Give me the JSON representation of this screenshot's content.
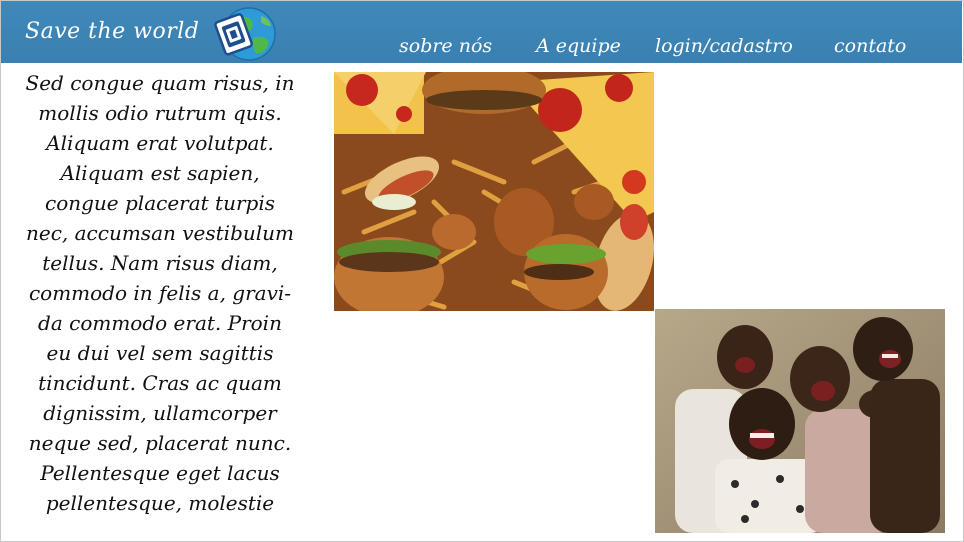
{
  "header": {
    "brand": "Save the world",
    "logo_icon": "globe-logo-icon",
    "background": "#3a80b0"
  },
  "nav": {
    "items": [
      {
        "label": "sobre nós"
      },
      {
        "label": "A equipe"
      },
      {
        "label": "login/cadastro"
      },
      {
        "label": "contato"
      }
    ]
  },
  "main": {
    "text_lines": [
      "Sed congue quam risus, in",
      "mollis odio rutrum quis.",
      "Aliquam erat volutpat.",
      "Aliquam est sapien,",
      "congue placerat turpis",
      "nec, accumsan vestibulum",
      "tellus. Nam risus diam,",
      "commodo in felis a, gravi-",
      "da commodo erat. Proin",
      "eu dui vel sem sagittis",
      "tincidunt. Cras ac quam",
      "dignissim, ullamcorper",
      "neque sed, placerat nunc.",
      "Pellentesque eget lacus",
      "pellentesque, molestie"
    ]
  },
  "images": {
    "food": "fast-food-photo",
    "children": "laughing-children-photo"
  }
}
